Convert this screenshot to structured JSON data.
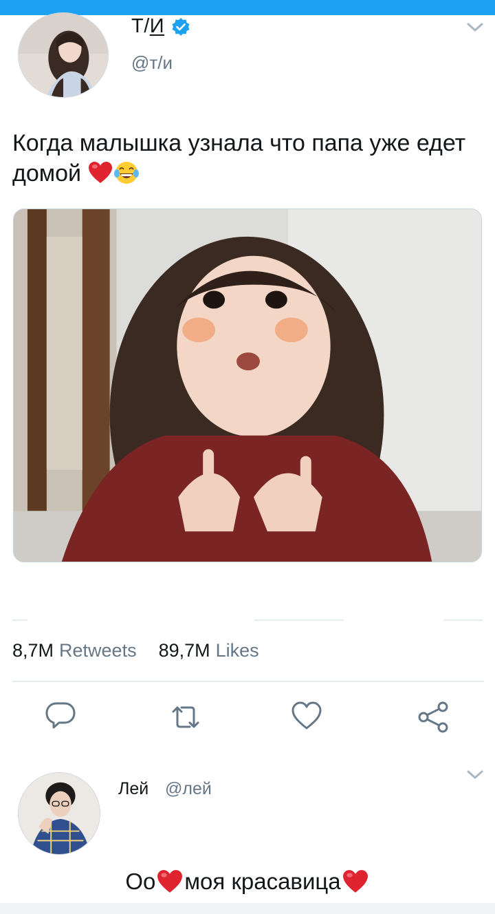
{
  "colors": {
    "accent": "#1da1f2",
    "text": "#14171a",
    "secondary": "#657786",
    "divider": "#e6ecf0",
    "heart": "#e0242f"
  },
  "tweet": {
    "display_name_prefix": "Т/",
    "display_name_underlined": "И",
    "verified_icon": "verified-badge-icon",
    "handle": "@т/и",
    "text": "Когда малышка узнала что папа уже едет домой",
    "text_emoji": [
      "red-heart-emoji",
      "tears-of-joy-emoji"
    ],
    "media_description_icon": "photo-child-portrait",
    "stats": {
      "retweets_count": "8,7M",
      "retweets_label": "Retweets",
      "likes_count": "89,7M",
      "likes_label": "Likes"
    },
    "actions": [
      "reply-icon",
      "retweet-icon",
      "like-icon",
      "share-icon"
    ]
  },
  "reply": {
    "display_name": "Лей",
    "handle": "@лей",
    "text_part1": "Оо",
    "text_part2": "моя красавица"
  }
}
